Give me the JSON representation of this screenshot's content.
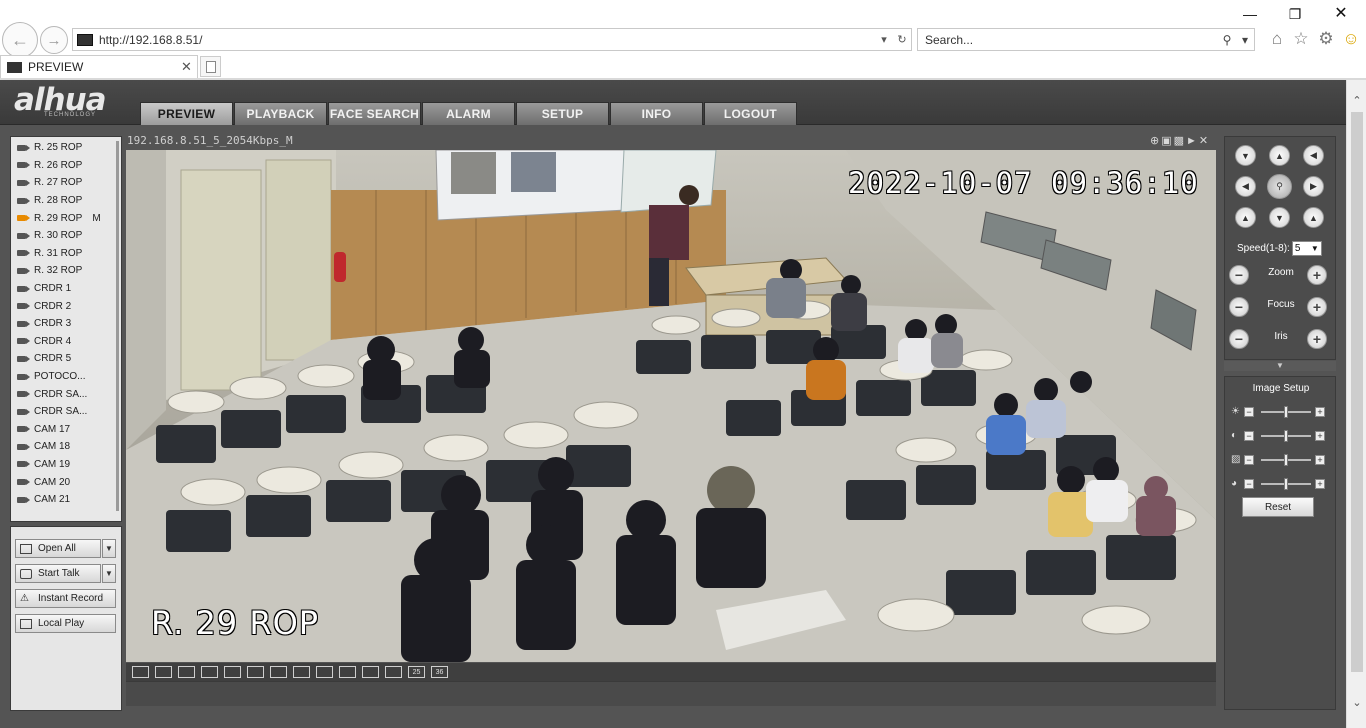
{
  "browser": {
    "url": "http://192.168.8.51/",
    "search_placeholder": "Search...",
    "tab_title": "PREVIEW"
  },
  "app": {
    "logo": "alhua",
    "logo_sub": "TECHNOLOGY",
    "nav": [
      "PREVIEW",
      "PLAYBACK",
      "FACE SEARCH",
      "ALARM",
      "SETUP",
      "INFO",
      "LOGOUT"
    ],
    "active_nav": "PREVIEW"
  },
  "cameras": [
    "R. 25 ROP",
    "R. 26 ROP",
    "R. 27 ROP",
    "R. 28 ROP",
    "R. 29 ROP",
    "R. 30 ROP",
    "R. 31 ROP",
    "R. 32 ROP",
    "CRDR 1",
    "CRDR 2",
    "CRDR 3",
    "CRDR 4",
    "CRDR 5",
    "POTOCO...",
    "CRDR SA...",
    "CRDR SA...",
    "CAM 17",
    "CAM 18",
    "CAM 19",
    "CAM 20",
    "CAM 21"
  ],
  "active_camera_badge": "M",
  "controls": {
    "open_all": "Open All",
    "start_talk": "Start Talk",
    "instant_record": "Instant Record",
    "local_play": "Local Play"
  },
  "video": {
    "stream_title": "192.168.8.51_5_2054Kbps_M",
    "osd_time": "2022-10-07 09:36:10",
    "osd_name": "R. 29 ROP",
    "split_labels": [
      "25",
      "36"
    ]
  },
  "ptz": {
    "speed_label": "Speed(1-8):",
    "speed_value": "5",
    "zoom": "Zoom",
    "focus": "Focus",
    "iris": "Iris"
  },
  "image_setup": {
    "title": "Image Setup",
    "reset": "Reset",
    "sliders": [
      {
        "name": "brightness",
        "icon": "sun-icon",
        "level": 0.5
      },
      {
        "name": "contrast",
        "icon": "contrast-icon",
        "level": 0.5
      },
      {
        "name": "saturation",
        "icon": "saturation-icon",
        "level": 0.5
      },
      {
        "name": "hue",
        "icon": "hue-icon",
        "level": 0.5
      }
    ]
  },
  "colors": {
    "active_camera": "#e88a00",
    "panel_bg": "#545454"
  }
}
